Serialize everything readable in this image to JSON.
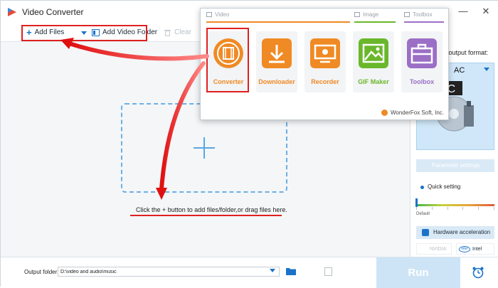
{
  "window": {
    "title": "Video Converter"
  },
  "toolbar": {
    "add_files": "Add Files",
    "add_video_folder": "Add Video Folder",
    "clear": "Clear"
  },
  "popup": {
    "categories": {
      "video": "Video",
      "image": "Image",
      "toolbox": "Toolbox"
    },
    "tiles": [
      {
        "label": "Converter",
        "icon": "film-reel-icon",
        "color": "#f08a24"
      },
      {
        "label": "Downloader",
        "icon": "download-icon",
        "color": "#f08a24"
      },
      {
        "label": "Recorder",
        "icon": "screen-record-icon",
        "color": "#f08a24"
      },
      {
        "label": "GIF Maker",
        "icon": "image-icon",
        "color": "#6ab72b"
      },
      {
        "label": "Toolbox",
        "icon": "toolbox-icon",
        "color": "#9b6fc6"
      }
    ],
    "brand": "WonderFox Soft, Inc."
  },
  "main": {
    "hint": "Click the + button to add files/folder,or drag files here."
  },
  "right_panel": {
    "output_format_label": "e output format:",
    "format_name": "AC",
    "format_art_text": "AC",
    "parameter_settings": "Parameter settings",
    "quick_setting": "Quick setting",
    "default_label": "Default",
    "hardware_acceleration": "Hardware acceleration",
    "nvidia": "NVIDIA",
    "intel": "Intel"
  },
  "bottom": {
    "output_folder_label": "Output folder:",
    "output_folder_value": "D:\\video and audio\\music",
    "run": "Run"
  },
  "colors": {
    "accent": "#1a73c9",
    "highlight": "#e02020",
    "orange": "#f08a24",
    "green": "#6ab72b",
    "purple": "#9b6fc6"
  }
}
